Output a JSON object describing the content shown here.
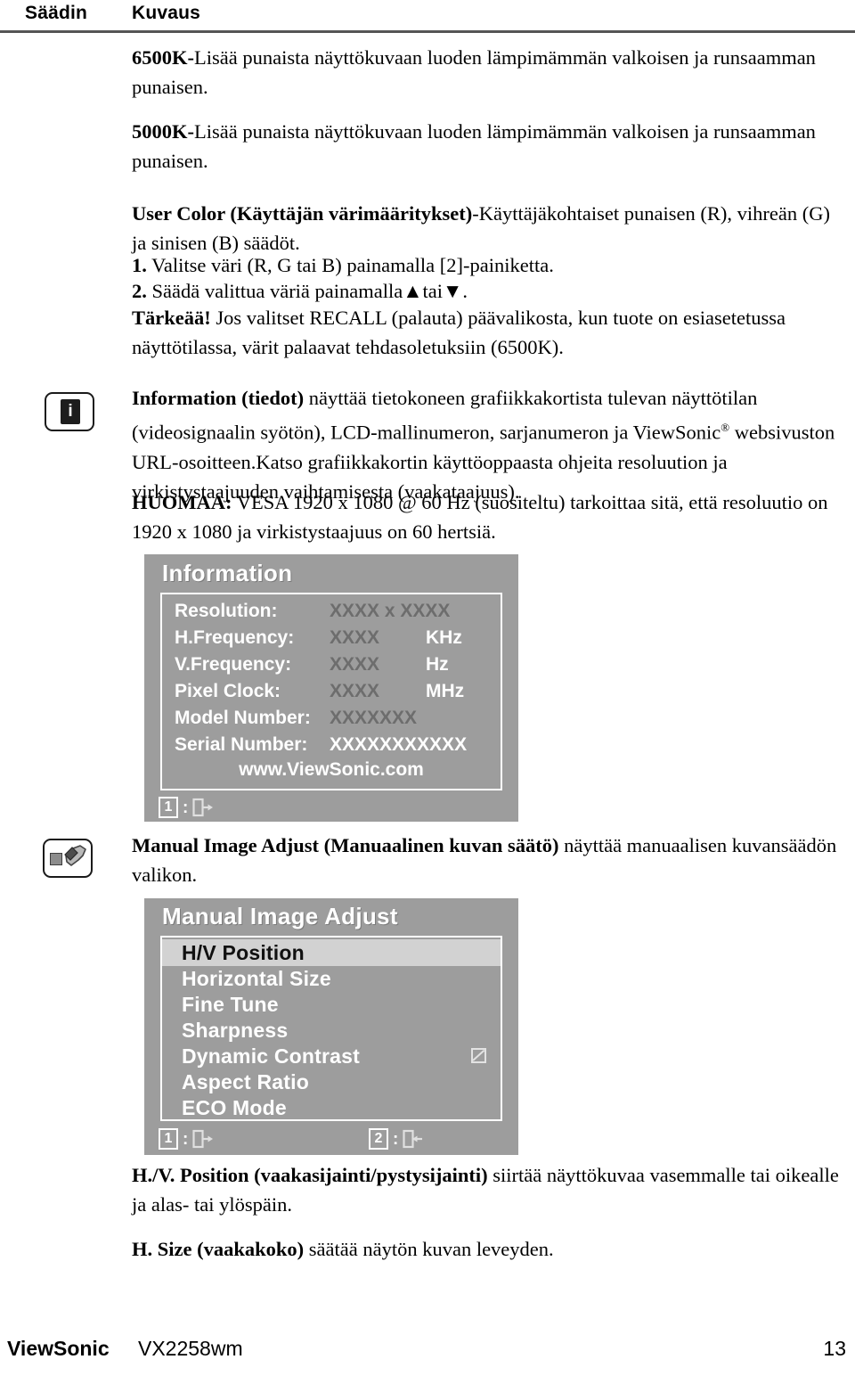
{
  "header": {
    "col1": "Säädin",
    "col2": "Kuvaus"
  },
  "body": {
    "p_6500k_bold": "6500K-",
    "p_6500k_text": "Lisää punaista näyttökuvaan luoden lämpimämmän valkoisen ja runsaamman punaisen.",
    "p_5000k_bold": "5000K-",
    "p_5000k_text": "Lisää punaista näyttökuvaan luoden lämpimämmän valkoisen ja runsaamman punaisen.",
    "p_usercolor_bold": "User Color (Käyttäjän värimääritykset)",
    "p_usercolor_text": "-Käyttäjäkohtaiset punaisen (R), vihreän (G) ja sinisen (B) säädöt.",
    "step1_num": "1.",
    "step1_text": "Valitse väri (R, G tai B) painamalla [2]-painiketta.",
    "step2_num": "2.",
    "step2_text_a": "Säädä valittua väriä painamalla",
    "step2_up": "▲",
    "step2_tai": "tai",
    "step2_down": "▼",
    "step2_text_b": ".",
    "p_tarkeaa_bold": "Tärkeää!",
    "p_tarkeaa_text": " Jos valitset RECALL (palauta) päävalikosta, kun tuote on esiasetetussa näyttötilassa, värit palaavat tehdasoletuksiin (6500K).",
    "p_info_bold": "Information (tiedot)",
    "p_info_text_1": " näyttää tietokoneen grafiikkakortista tulevan näyttötilan (videosignaalin syötön), LCD-mallinumeron, sarjanumeron ja ViewSonic",
    "p_info_reg": "®",
    "p_info_text_2": " websivuston URL-osoitteen.Katso grafiikkakortin käyttöoppaasta ohjeita resoluution ja virkistystaajuuden vaihtamisesta (vaakataajuus).",
    "p_huomaa_bold": "HUOMAA:",
    "p_huomaa_text": " VESA 1920 x 1080 @ 60 Hz (suositeltu) tarkoittaa sitä, että resoluutio on 1920 x 1080 ja virkistystaajuus on 60 hertsiä.",
    "p_manual_bold": "Manual Image Adjust (Manuaalinen kuvan säätö)",
    "p_manual_text": " näyttää manuaalisen kuvansäädön valikon.",
    "p_hv_bold": "H./V. Position (vaakasijainti/pystysijainti)",
    "p_hv_text": " siirtää näyttökuvaa vasemmalle tai oikealle ja alas- tai ylöspäin.",
    "p_hsize_bold": "H. Size (vaakakoko)",
    "p_hsize_text": " säätää näytön kuvan leveyden."
  },
  "icons": {
    "info": "info-icon",
    "manual_adjust": "wrench-icon"
  },
  "osd_information": {
    "title": "Information",
    "rows": [
      {
        "label": "Resolution:",
        "value": "XXXX x XXXX",
        "unit": ""
      },
      {
        "label": "H.Frequency:",
        "value": "XXXX",
        "unit": "KHz"
      },
      {
        "label": "V.Frequency:",
        "value": "XXXX",
        "unit": "Hz"
      },
      {
        "label": "Pixel Clock:",
        "value": "XXXX",
        "unit": "MHz"
      },
      {
        "label": "Model Number:",
        "value": "XXXXXXX",
        "unit": ""
      },
      {
        "label": "Serial Number:",
        "value": "XXXXXXXXXXX",
        "unit": ""
      }
    ],
    "url": "www.ViewSonic.com",
    "footer": {
      "key1": "1",
      "colon": ":",
      "key1_icon": "exit-icon"
    },
    "colors": {
      "panel_bg": "#9d9d9d",
      "label_fg": "#ffffff",
      "value_fg": "#6d6d6d"
    }
  },
  "osd_manual_image_adjust": {
    "title": "Manual Image Adjust",
    "items": [
      {
        "label": "H/V Position",
        "selected": true,
        "checkbox": false
      },
      {
        "label": "Horizontal Size",
        "selected": false,
        "checkbox": false
      },
      {
        "label": "Fine Tune",
        "selected": false,
        "checkbox": false
      },
      {
        "label": "Sharpness",
        "selected": false,
        "checkbox": false
      },
      {
        "label": "Dynamic Contrast",
        "selected": false,
        "checkbox": true
      },
      {
        "label": "Aspect Ratio",
        "selected": false,
        "checkbox": false
      },
      {
        "label": "ECO Mode",
        "selected": false,
        "checkbox": false
      }
    ],
    "footer": {
      "key1": "1",
      "key1_colon": ":",
      "key1_icon": "exit-icon",
      "key2": "2",
      "key2_colon": ":",
      "key2_icon": "enter-icon"
    },
    "colors": {
      "panel_bg": "#9d9d9d",
      "selected_bg": "#d2d2d2",
      "selected_fg": "#111111",
      "item_fg": "#ffffff"
    }
  },
  "footer": {
    "brand": "ViewSonic",
    "model": "VX2258wm",
    "page": "13"
  }
}
